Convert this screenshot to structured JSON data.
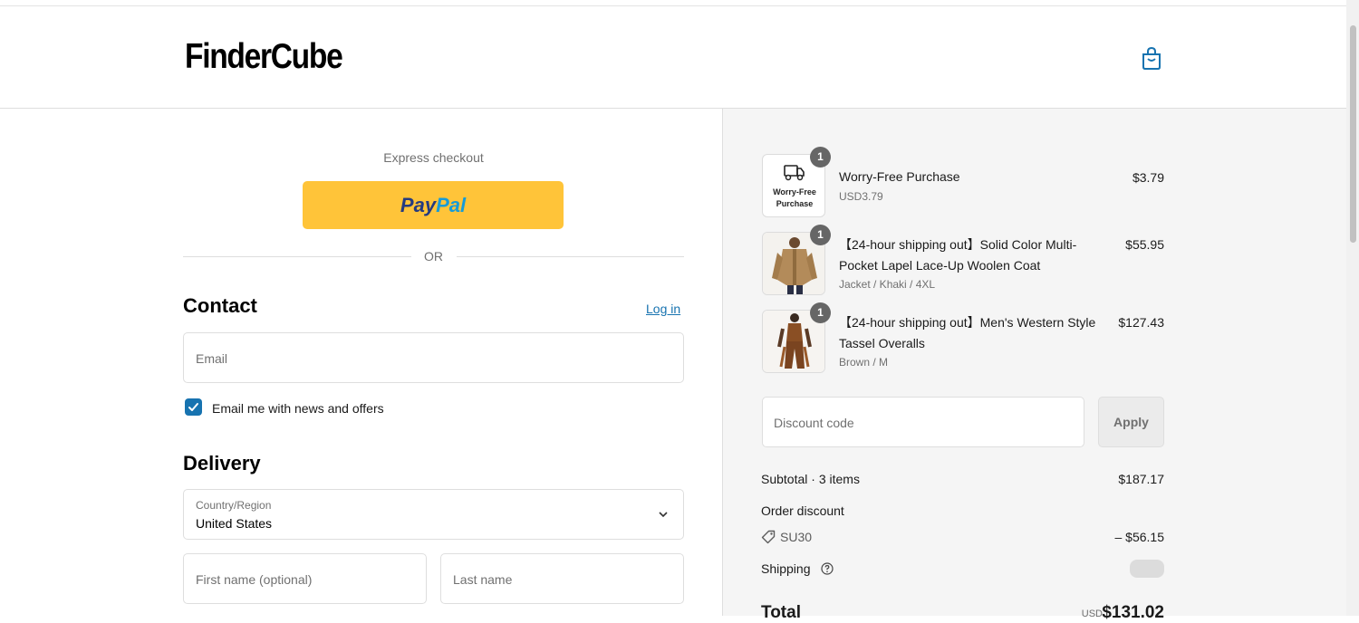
{
  "brand": {
    "logo_text": "FinderCube"
  },
  "header": {
    "cart_icon": "shopping-bag-icon"
  },
  "checkout": {
    "express_label": "Express checkout",
    "paypal_part1": "Pay",
    "paypal_part2": "Pal",
    "or_label": "OR",
    "contact": {
      "heading": "Contact",
      "login_link": "Log in",
      "email_placeholder": "Email",
      "newsletter_label": "Email me with news and offers",
      "newsletter_checked": true
    },
    "delivery": {
      "heading": "Delivery",
      "country_label": "Country/Region",
      "country_value": "United States",
      "first_name_placeholder": "First name (optional)",
      "last_name_placeholder": "Last name"
    }
  },
  "summary": {
    "items": [
      {
        "name": "Worry-Free Purchase",
        "variant": "USD3.79",
        "price": "$3.79",
        "qty": "1",
        "thumb_text_1": "Worry-Free",
        "thumb_text_2": "Purchase"
      },
      {
        "name": "【24-hour shipping out】Solid Color Multi-Pocket Lapel Lace-Up Woolen Coat",
        "variant": "Jacket / Khaki / 4XL",
        "price": "$55.95",
        "qty": "1"
      },
      {
        "name": "【24-hour shipping out】Men's Western Style Tassel Overalls",
        "variant": "Brown / M",
        "price": "$127.43",
        "qty": "1"
      }
    ],
    "discount_placeholder": "Discount code",
    "apply_label": "Apply",
    "subtotal_label": "Subtotal · 3 items",
    "subtotal_value": "$187.17",
    "order_discount_label": "Order discount",
    "discount_code": "SU30",
    "discount_value": "– $56.15",
    "shipping_label": "Shipping",
    "total_label": "Total",
    "total_currency": "USD",
    "total_value": "$131.02"
  },
  "colors": {
    "accent": "#1773b0",
    "paypal_yellow": "#ffc439",
    "summary_bg": "#f5f5f5"
  }
}
